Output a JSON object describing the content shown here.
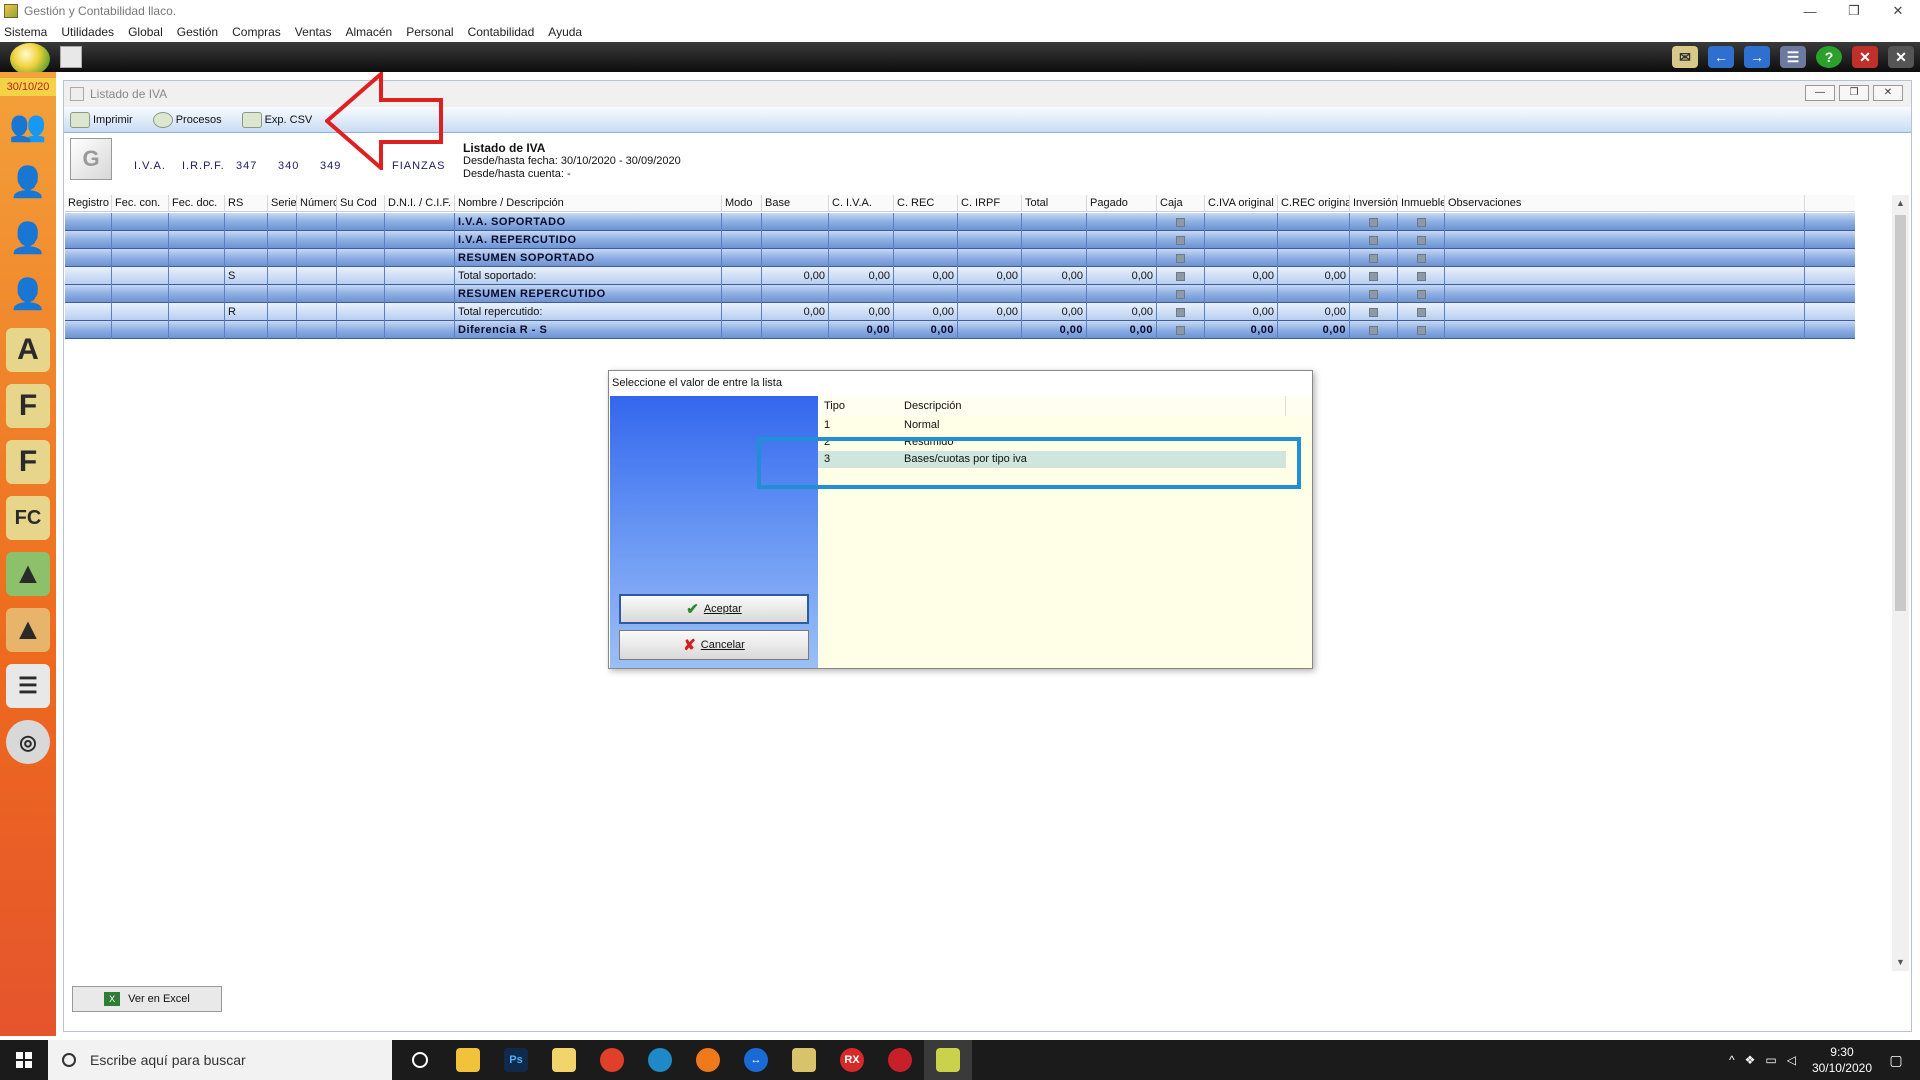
{
  "window": {
    "title": "Gestión y Contabilidad llaco.",
    "controls": [
      "—",
      "❐",
      "✕"
    ]
  },
  "menu": [
    "Sistema",
    "Utilidades",
    "Global",
    "Gestión",
    "Compras",
    "Ventas",
    "Almacén",
    "Personal",
    "Contabilidad",
    "Ayuda"
  ],
  "sidebar": {
    "date": "30/10/20"
  },
  "child": {
    "title": "Listado de IVA",
    "toolbar": {
      "print": "Imprimir",
      "process": "Procesos",
      "csv": "Exp. CSV"
    },
    "tabs": [
      "I.V.A.",
      "I.R.P.F.",
      "347",
      "340",
      "349",
      "FIANZAS"
    ],
    "info": {
      "heading": "Listado de IVA",
      "dates": "Desde/hasta fecha: 30/10/2020 - 30/09/2020",
      "accounts": "Desde/hasta cuenta:   -"
    },
    "excel_button": "Ver en Excel"
  },
  "grid": {
    "columns": [
      "Registro",
      "Fec. con.",
      "Fec. doc.",
      "RS",
      "Serie",
      "Número",
      "Su Cod",
      "D.N.I. / C.I.F.",
      "Nombre / Descripción",
      "Modo",
      "Base",
      "C. I.V.A.",
      "C. REC",
      "C. IRPF",
      "Total",
      "Pagado",
      "Caja",
      "C.IVA original",
      "C.REC original",
      "Inversión",
      "Inmueble",
      "Observaciones"
    ],
    "rows": [
      {
        "type": "band",
        "rs": "",
        "name": "I.V.A. SOPORTADO",
        "values": [
          "",
          "",
          "",
          "",
          "",
          "",
          "",
          ""
        ]
      },
      {
        "type": "band",
        "rs": "",
        "name": "I.V.A. REPERCUTIDO",
        "values": [
          "",
          "",
          "",
          "",
          "",
          "",
          "",
          ""
        ]
      },
      {
        "type": "band",
        "rs": "",
        "name": "RESUMEN SOPORTADO",
        "values": [
          "",
          "",
          "",
          "",
          "",
          "",
          "",
          ""
        ]
      },
      {
        "type": "light",
        "rs": "S",
        "name": "Total soportado:",
        "values": [
          "0,00",
          "0,00",
          "0,00",
          "0,00",
          "0,00",
          "0,00",
          "0,00",
          "0,00"
        ]
      },
      {
        "type": "band",
        "rs": "",
        "name": "RESUMEN REPERCUTIDO",
        "values": [
          "",
          "",
          "",
          "",
          "",
          "",
          "",
          ""
        ]
      },
      {
        "type": "light",
        "rs": "R",
        "name": "Total repercutido:",
        "values": [
          "0,00",
          "0,00",
          "0,00",
          "0,00",
          "0,00",
          "0,00",
          "0,00",
          "0,00"
        ]
      },
      {
        "type": "band",
        "rs": "",
        "name": "Diferencia R - S",
        "values": [
          "",
          "0,00",
          "0,00",
          "",
          "0,00",
          "0,00",
          "0,00",
          "0,00"
        ]
      }
    ]
  },
  "dialog": {
    "title": "Seleccione el valor de entre la lista",
    "columns": {
      "tipo": "Tipo",
      "desc": "Descripción"
    },
    "items": [
      {
        "tipo": "1",
        "desc": "Normal"
      },
      {
        "tipo": "2",
        "desc": "Resumido"
      },
      {
        "tipo": "3",
        "desc": "Bases/cuotas por tipo iva"
      }
    ],
    "selected_index": 2,
    "accept": "Aceptar",
    "cancel": "Cancelar"
  },
  "taskbar": {
    "search_placeholder": "Escribe aquí para buscar",
    "time": "9:30",
    "date": "30/10/2020"
  },
  "colors": {
    "accent": "#1f8fd6",
    "annotation_arrow": "#e02020",
    "grid_band": "#8fb0e3"
  }
}
